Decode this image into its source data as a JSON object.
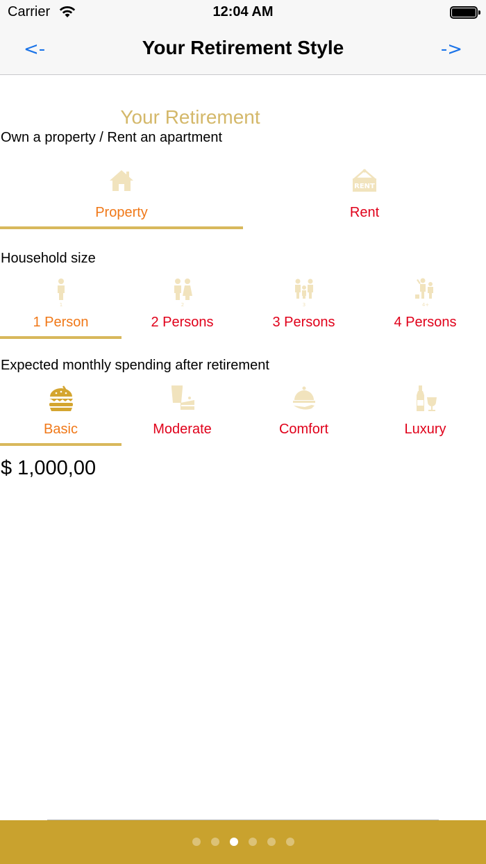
{
  "status_bar": {
    "carrier": "Carrier",
    "time": "12:04 AM"
  },
  "nav": {
    "back_label": "<-",
    "title": "Your Retirement Style",
    "forward_label": "->"
  },
  "section_title": "Your Retirement",
  "ownership": {
    "label": "Own a property / Rent an apartment",
    "options": [
      {
        "label": "Property",
        "icon": "house-icon",
        "selected": true
      },
      {
        "label": "Rent",
        "icon": "rent-sign-icon",
        "selected": false
      }
    ]
  },
  "household": {
    "label": "Household size",
    "options": [
      {
        "label": "1 Person",
        "icon": "one-person-icon",
        "selected": true
      },
      {
        "label": "2 Persons",
        "icon": "two-persons-icon",
        "selected": false
      },
      {
        "label": "3 Persons",
        "icon": "three-persons-icon",
        "selected": false
      },
      {
        "label": "4 Persons",
        "icon": "four-persons-icon",
        "selected": false
      }
    ]
  },
  "spending": {
    "label": "Expected monthly spending after retirement",
    "options": [
      {
        "label": "Basic",
        "icon": "burger-icon",
        "selected": true
      },
      {
        "label": "Moderate",
        "icon": "drinks-cake-icon",
        "selected": false
      },
      {
        "label": "Comfort",
        "icon": "cloche-icon",
        "selected": false
      },
      {
        "label": "Luxury",
        "icon": "wine-icon",
        "selected": false
      }
    ],
    "amount": "$ 1,000,00"
  },
  "page_control": {
    "count": 6,
    "active_index": 2
  },
  "colors": {
    "accent_gold": "#d8b85c",
    "footer_gold": "#c9a22e",
    "selected_text": "#f07818",
    "unselected_text": "#e0001a",
    "link_blue": "#1a73e8",
    "icon_faded": "#f1e3bd",
    "icon_active": "#d4a530"
  }
}
